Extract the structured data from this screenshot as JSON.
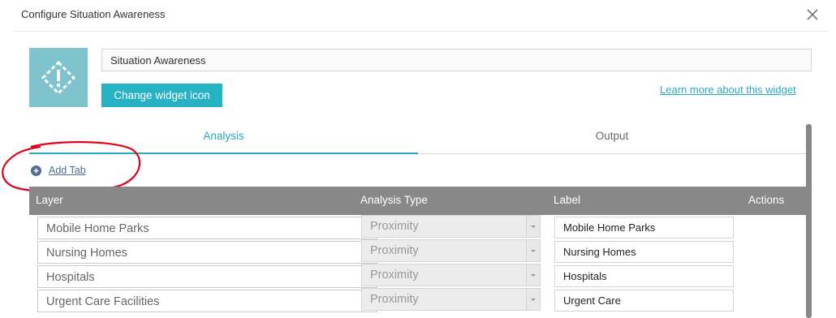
{
  "dialog": {
    "title": "Configure Situation Awareness"
  },
  "widget": {
    "name_value": "Situation Awareness",
    "change_icon_label": "Change widget icon",
    "learn_more_label": "Learn more about this widget"
  },
  "tabs": [
    {
      "label": "Analysis",
      "active": true
    },
    {
      "label": "Output",
      "active": false
    }
  ],
  "add_tab_label": "Add Tab",
  "table": {
    "columns": [
      "Layer",
      "Analysis Type",
      "Label",
      "Actions"
    ],
    "rows": [
      {
        "layer": "Mobile Home Parks",
        "analysis_type": "Proximity",
        "label": "Mobile Home Parks"
      },
      {
        "layer": "Nursing Homes",
        "analysis_type": "Proximity",
        "label": "Nursing Homes"
      },
      {
        "layer": "Hospitals",
        "analysis_type": "Proximity",
        "label": "Hospitals"
      },
      {
        "layer": "Urgent Care Facilities",
        "analysis_type": "Proximity",
        "label": "Urgent Care"
      }
    ]
  },
  "colors": {
    "accent": "#25b2c2",
    "icon_tile": "#7fc3cc",
    "header": "#888888",
    "annotation": "#e3001b"
  }
}
